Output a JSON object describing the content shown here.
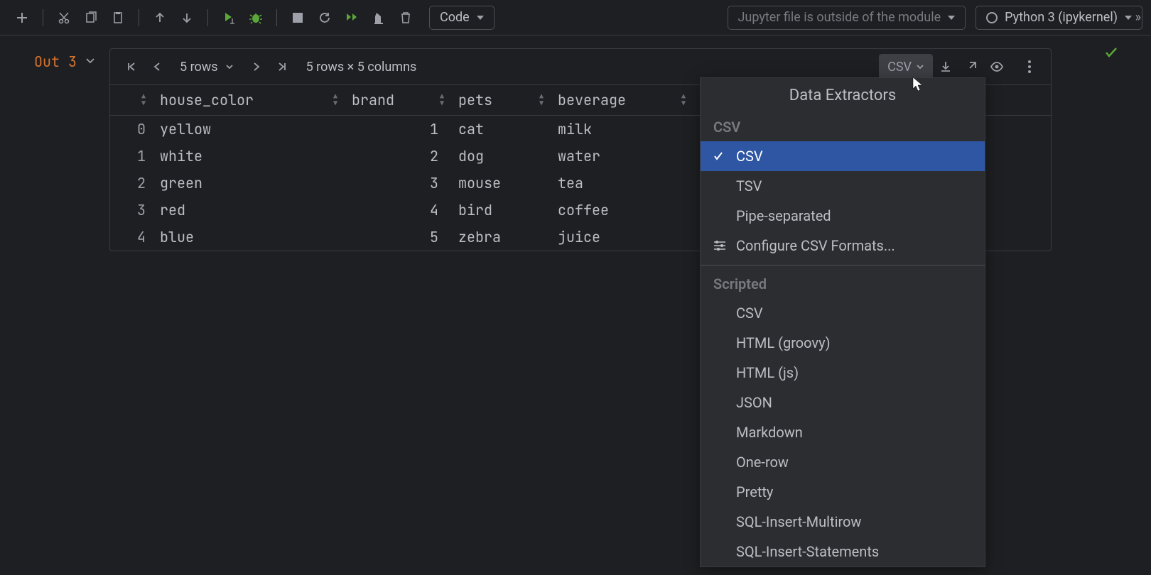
{
  "toolbar": {
    "code_dropdown": "Code",
    "jupyter_warning": "Jupyter file is outside of the module",
    "kernel": "Python 3 (ipykernel)"
  },
  "out_label": "Out 3",
  "panel": {
    "rows_dropdown": "5 rows",
    "dims": "5 rows × 5 columns",
    "export_label": "CSV"
  },
  "table": {
    "columns": [
      "",
      "house_color",
      "brand",
      "pets",
      "beverage"
    ],
    "rows": [
      {
        "idx": "0",
        "house_color": "yellow",
        "brand": "1",
        "pets": "cat",
        "beverage": "milk"
      },
      {
        "idx": "1",
        "house_color": "white",
        "brand": "2",
        "pets": "dog",
        "beverage": "water"
      },
      {
        "idx": "2",
        "house_color": "green",
        "brand": "3",
        "pets": "mouse",
        "beverage": "tea"
      },
      {
        "idx": "3",
        "house_color": "red",
        "brand": "4",
        "pets": "bird",
        "beverage": "coffee"
      },
      {
        "idx": "4",
        "house_color": "blue",
        "brand": "5",
        "pets": "zebra",
        "beverage": "juice"
      }
    ]
  },
  "popup": {
    "title": "Data Extractors",
    "sections": [
      {
        "header": "CSV",
        "items": [
          {
            "label": "CSV",
            "selected": true
          },
          {
            "label": "TSV"
          },
          {
            "label": "Pipe-separated"
          },
          {
            "label": "Configure CSV Formats...",
            "icon": "settings"
          }
        ]
      },
      {
        "header": "Scripted",
        "items": [
          {
            "label": "CSV"
          },
          {
            "label": "HTML (groovy)"
          },
          {
            "label": "HTML (js)"
          },
          {
            "label": "JSON"
          },
          {
            "label": "Markdown"
          },
          {
            "label": "One-row"
          },
          {
            "label": "Pretty"
          },
          {
            "label": "SQL-Insert-Multirow"
          },
          {
            "label": "SQL-Insert-Statements"
          }
        ]
      }
    ]
  }
}
